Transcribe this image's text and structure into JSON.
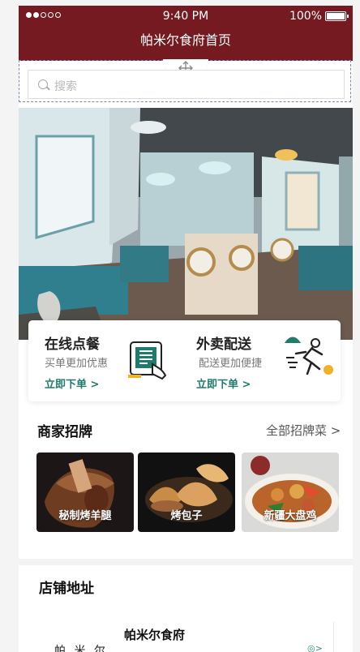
{
  "status_bar": {
    "time": "9:40 PM",
    "battery": "100%"
  },
  "header": {
    "title": "帕米尔食府首页"
  },
  "search": {
    "placeholder": "搜索"
  },
  "order_card": {
    "left": {
      "title": "在线点餐",
      "subtitle": "买单更加优惠",
      "link": "立即下单 >"
    },
    "right": {
      "title": "外卖配送",
      "subtitle": "配送更加便捷",
      "link": "立即下单 >"
    }
  },
  "signature": {
    "title": "商家招牌",
    "all_link": "全部招牌菜 >",
    "items": [
      {
        "label": "秘制烤羊腿"
      },
      {
        "label": "烤包子"
      },
      {
        "label": "新疆大盘鸡"
      }
    ]
  },
  "address": {
    "title": "店铺地址",
    "shop_name": "帕米尔食府",
    "logo_text": "帕 米 尔"
  },
  "colors": {
    "brand": "#741a20",
    "accent": "#1f7b6c"
  },
  "icons": [
    "move-icon",
    "search-icon",
    "tablet-order-icon",
    "delivery-runner-icon",
    "map-navigation-icon"
  ]
}
